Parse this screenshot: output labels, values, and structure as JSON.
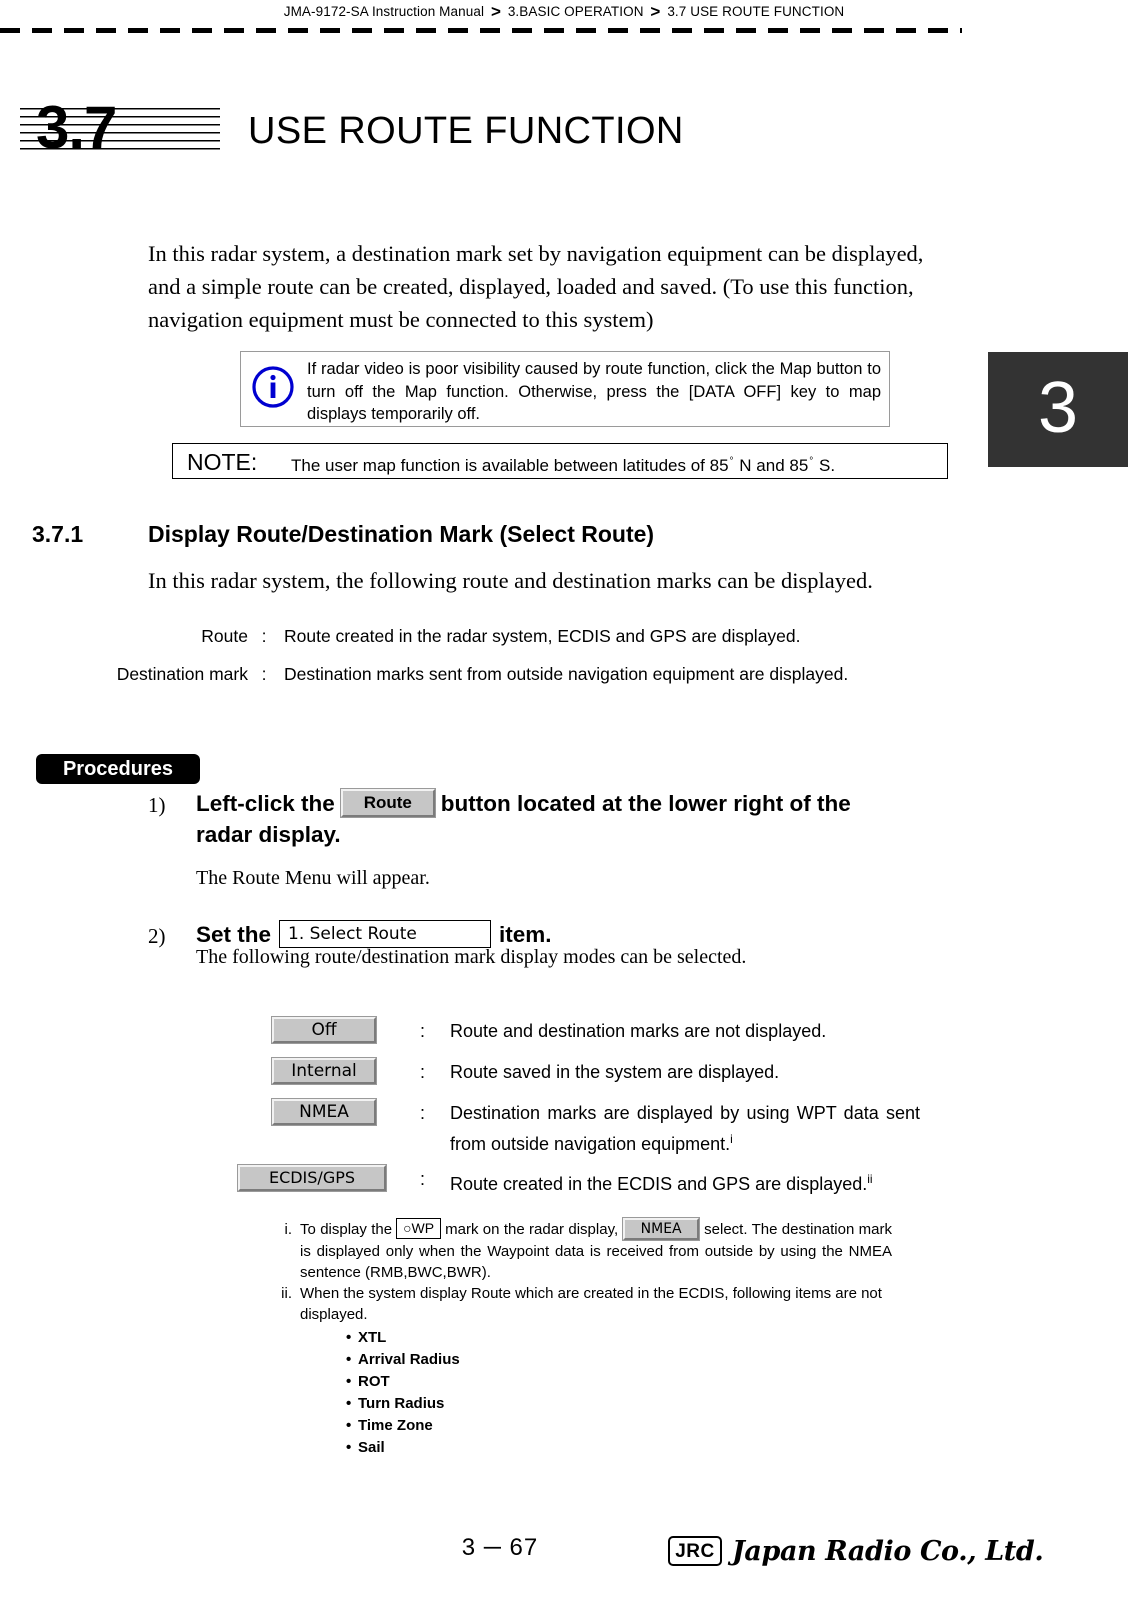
{
  "header": {
    "manual": "JMA-9172-SA Instruction Manual",
    "sep": ">",
    "chapter": "3.BASIC OPERATION",
    "section": "3.7  USE ROUTE FUNCTION"
  },
  "chapter_tab": "3",
  "section_heading": {
    "number": "3.7",
    "title": "USE ROUTE FUNCTION"
  },
  "intro": "In this radar system, a destination mark set by navigation equipment can be displayed, and a simple route can be created, displayed, loaded and saved. (To use this function, navigation equipment must be connected to this system)",
  "info_box": {
    "icon": "info-circle-icon",
    "icon_color": "#0000d0",
    "text": "If radar video is poor visibility caused by route function, click the Map  button to turn off the Map function. Otherwise, press the [DATA OFF] key to map displays temporarily off."
  },
  "note_box": {
    "label": "NOTE:",
    "text_a": "The user map function is available between latitudes of 85",
    "deg": "°",
    "text_b": "N and 85",
    "text_c": "S."
  },
  "subsection": {
    "number": "3.7.1",
    "title": "Display Route/Destination Mark (Select Route)",
    "lead": "In this radar system, the following route and destination marks can be displayed."
  },
  "definitions": [
    {
      "term": "Route",
      "colon": ":",
      "desc": "Route created in the radar system, ECDIS and GPS are displayed."
    },
    {
      "term": "Destination mark",
      "colon": ":",
      "desc": "Destination marks sent from outside navigation equipment are displayed."
    }
  ],
  "procedures_badge": "Procedures",
  "steps": {
    "step1": {
      "marker": "1)",
      "text_before": "Left-click the",
      "button": "Route",
      "text_after": "button located at the lower right of the",
      "line2": "radar display.",
      "note": "The Route Menu will appear."
    },
    "step2": {
      "marker": "2)",
      "text_before": "Set the",
      "field": "1. Select Route",
      "text_after": "item.",
      "note": "The following route/destination mark display modes can be selected."
    }
  },
  "options": [
    {
      "button": "Off",
      "colon": ":",
      "desc": "Route and destination marks are not displayed.",
      "footnote": ""
    },
    {
      "button": "Internal",
      "colon": ":",
      "desc": "Route saved in the system are displayed.",
      "footnote": ""
    },
    {
      "button": "NMEA",
      "colon": ":",
      "desc": "Destination marks are displayed by using WPT data sent from outside navigation equipment.",
      "footnote": "i"
    },
    {
      "button": "ECDIS/GPS",
      "colon": ":",
      "desc": "Route created in the ECDIS and GPS are displayed.",
      "footnote": "ii"
    }
  ],
  "footnotes": {
    "i": {
      "mark": "i.",
      "part1": "To display the",
      "wp_mark": "○WP",
      "part2": "mark on the radar display,",
      "btn": "NMEA",
      "part3": "select. The destination mark is displayed only when the Waypoint data is received from outside by using the NMEA sentence (RMB,BWC,BWR)."
    },
    "ii": {
      "mark": "ii.",
      "text": "When the system display Route which are created in the ECDIS, following items are not displayed.",
      "items": [
        "XTL",
        "Arrival Radius",
        "ROT",
        "Turn Radius",
        "Time Zone",
        "Sail"
      ]
    }
  },
  "footer": {
    "page": "3 ─ 67",
    "logo_mark": "JRC",
    "logo_name": "Japan Radio Co., Ltd."
  }
}
